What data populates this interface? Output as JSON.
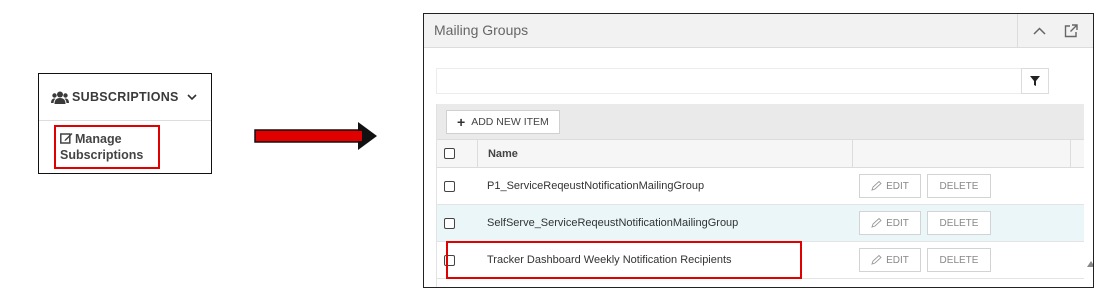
{
  "subscriptions": {
    "title": "SUBSCRIPTIONS",
    "item_label": "Manage Subscriptions"
  },
  "mailing_groups": {
    "title": "Mailing Groups",
    "search": {
      "value": "",
      "placeholder": ""
    },
    "add_button_label": "ADD NEW ITEM",
    "columns": {
      "name": "Name"
    },
    "rows": [
      {
        "name": "P1_ServiceReqeustNotificationMailingGroup",
        "edit": "EDIT",
        "delete": "DELETE"
      },
      {
        "name": "SelfServe_ServiceReqeustNotificationMailingGroup",
        "edit": "EDIT",
        "delete": "DELETE"
      },
      {
        "name": "Tracker Dashboard Weekly Notification Recipients",
        "edit": "EDIT",
        "delete": "DELETE"
      }
    ]
  },
  "icons": [
    "users-icon",
    "chevron-down-icon",
    "edit-icon",
    "arrow-right-icon",
    "chevron-up-icon",
    "popout-icon",
    "filter-icon",
    "plus-icon",
    "pencil-icon",
    "scroll-up-icon"
  ],
  "colors": {
    "highlight": "#e00000",
    "arrow": "#e00000",
    "alt_row": "#eaf6f8",
    "toolbar": "#eaeaea"
  }
}
